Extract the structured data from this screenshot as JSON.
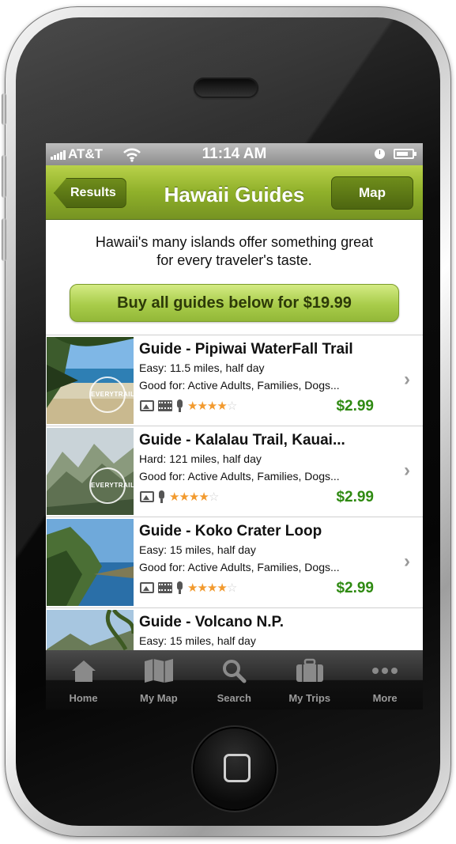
{
  "status_bar": {
    "carrier": "AT&T",
    "time": "11:14 AM"
  },
  "nav": {
    "back_label": "Results",
    "title": "Hawaii Guides",
    "map_label": "Map"
  },
  "intro_text": "Hawaii's many islands offer something great for every traveler's taste.",
  "buy_all_label": "Buy all guides below for $19.99",
  "badge_text": "EVERYTRAIL GUIDE",
  "guides": [
    {
      "title": "Guide - Pipiwai WaterFall Trail",
      "detail": "Easy: 11.5 miles, half day",
      "good_for": "Good for: Active Adults, Families, Dogs...",
      "price": "$2.99",
      "rating": 3.5,
      "media": [
        "photo-icon",
        "video-icon",
        "audio-icon"
      ],
      "thumb": "beach",
      "badge": true
    },
    {
      "title": "Guide - Kalalau Trail, Kauai...",
      "detail": "Hard: 121 miles, half day",
      "good_for": "Good for: Active Adults, Families, Dogs...",
      "price": "$2.99",
      "rating": 3.5,
      "media": [
        "photo-icon",
        "audio-icon"
      ],
      "thumb": "mountains",
      "badge": true
    },
    {
      "title": "Guide - Koko Crater Loop",
      "detail": "Easy: 15 miles, half day",
      "good_for": "Good for: Active Adults, Families, Dogs...",
      "price": "$2.99",
      "rating": 3.5,
      "media": [
        "photo-icon",
        "video-icon",
        "audio-icon"
      ],
      "thumb": "coast",
      "badge": false
    },
    {
      "title": "Guide - Volcano N.P.",
      "detail": "Easy: 15 miles, half day",
      "good_for": "",
      "price": "",
      "rating": 0,
      "media": [],
      "thumb": "palm",
      "badge": false
    }
  ],
  "tabs": [
    {
      "label": "Home",
      "icon": "home-icon"
    },
    {
      "label": "My Map",
      "icon": "map-icon"
    },
    {
      "label": "Search",
      "icon": "search-icon"
    },
    {
      "label": "My Trips",
      "icon": "suitcase-icon"
    },
    {
      "label": "More",
      "icon": "more-icon"
    }
  ],
  "colors": {
    "nav_green": "#8fb02a",
    "price_green": "#2f8a12",
    "star_orange": "#f29a2e"
  }
}
